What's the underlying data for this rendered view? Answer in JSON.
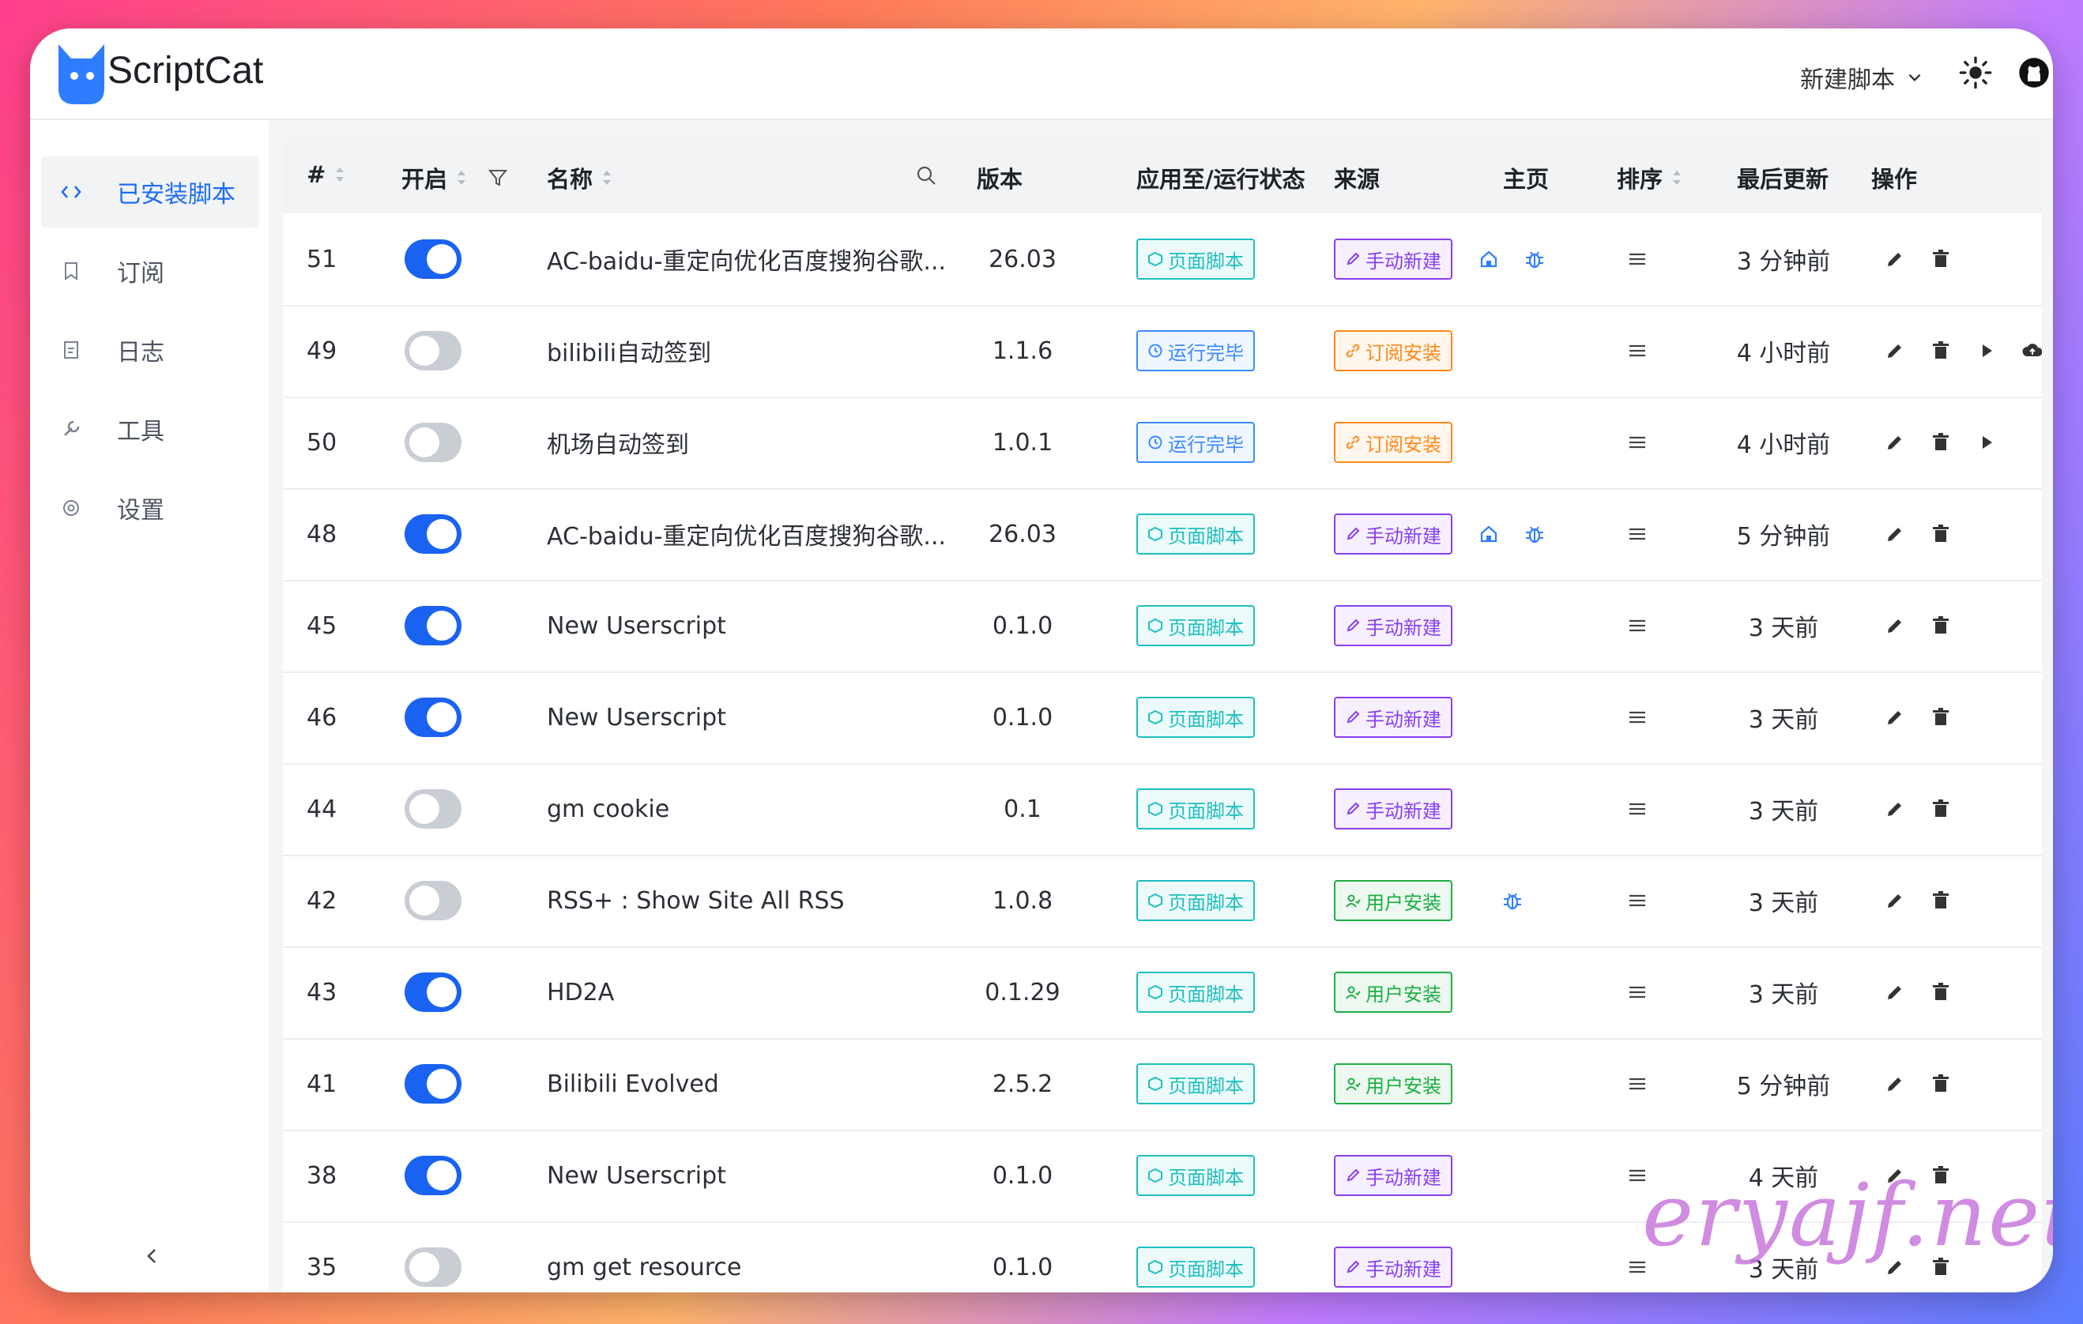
{
  "app": {
    "title": "ScriptCat"
  },
  "header": {
    "new_script_label": "新建脚本"
  },
  "sidebar": {
    "items": [
      {
        "label": "已安装脚本",
        "icon": "code-icon",
        "active": true
      },
      {
        "label": "订阅",
        "icon": "bookmark-icon",
        "active": false
      },
      {
        "label": "日志",
        "icon": "log-icon",
        "active": false
      },
      {
        "label": "工具",
        "icon": "wrench-icon",
        "active": false
      },
      {
        "label": "设置",
        "icon": "gear-icon",
        "active": false
      }
    ]
  },
  "table": {
    "columns": [
      "#",
      "开启",
      "名称",
      "版本",
      "应用至/运行状态",
      "来源",
      "主页",
      "排序",
      "最后更新",
      "操作"
    ],
    "rows": [
      {
        "id": "51",
        "enabled": true,
        "name": "AC-baidu-重定向优化百度搜狗谷歌...",
        "version": "26.03",
        "status": "页面脚本",
        "status_kind": "page",
        "source": "手动新建",
        "source_kind": "manual",
        "home": true,
        "bug": true,
        "updated": "3 分钟前",
        "play": false,
        "cloud": false
      },
      {
        "id": "49",
        "enabled": false,
        "name": "bilibili自动签到",
        "version": "1.1.6",
        "status": "运行完毕",
        "status_kind": "done",
        "source": "订阅安装",
        "source_kind": "sub",
        "home": false,
        "bug": false,
        "updated": "4 小时前",
        "play": true,
        "cloud": true
      },
      {
        "id": "50",
        "enabled": false,
        "name": "机场自动签到",
        "version": "1.0.1",
        "status": "运行完毕",
        "status_kind": "done",
        "source": "订阅安装",
        "source_kind": "sub",
        "home": false,
        "bug": false,
        "updated": "4 小时前",
        "play": true,
        "cloud": false
      },
      {
        "id": "48",
        "enabled": true,
        "name": "AC-baidu-重定向优化百度搜狗谷歌...",
        "version": "26.03",
        "status": "页面脚本",
        "status_kind": "page",
        "source": "手动新建",
        "source_kind": "manual",
        "home": true,
        "bug": true,
        "updated": "5 分钟前",
        "play": false,
        "cloud": false
      },
      {
        "id": "45",
        "enabled": true,
        "name": "New Userscript",
        "version": "0.1.0",
        "status": "页面脚本",
        "status_kind": "page",
        "source": "手动新建",
        "source_kind": "manual",
        "home": false,
        "bug": false,
        "updated": "3 天前",
        "play": false,
        "cloud": false
      },
      {
        "id": "46",
        "enabled": true,
        "name": "New Userscript",
        "version": "0.1.0",
        "status": "页面脚本",
        "status_kind": "page",
        "source": "手动新建",
        "source_kind": "manual",
        "home": false,
        "bug": false,
        "updated": "3 天前",
        "play": false,
        "cloud": false
      },
      {
        "id": "44",
        "enabled": false,
        "name": "gm cookie",
        "version": "0.1",
        "status": "页面脚本",
        "status_kind": "page",
        "source": "手动新建",
        "source_kind": "manual",
        "home": false,
        "bug": false,
        "updated": "3 天前",
        "play": false,
        "cloud": false
      },
      {
        "id": "42",
        "enabled": false,
        "name": "RSS+ : Show Site All RSS",
        "version": "1.0.8",
        "status": "页面脚本",
        "status_kind": "page",
        "source": "用户安装",
        "source_kind": "user",
        "home": false,
        "bug": true,
        "updated": "3 天前",
        "play": false,
        "cloud": false
      },
      {
        "id": "43",
        "enabled": true,
        "name": "HD2A",
        "version": "0.1.29",
        "status": "页面脚本",
        "status_kind": "page",
        "source": "用户安装",
        "source_kind": "user",
        "home": false,
        "bug": false,
        "updated": "3 天前",
        "play": false,
        "cloud": false
      },
      {
        "id": "41",
        "enabled": true,
        "name": "Bilibili Evolved",
        "version": "2.5.2",
        "status": "页面脚本",
        "status_kind": "page",
        "source": "用户安装",
        "source_kind": "user",
        "home": false,
        "bug": false,
        "updated": "5 分钟前",
        "play": false,
        "cloud": false
      },
      {
        "id": "38",
        "enabled": true,
        "name": "New Userscript",
        "version": "0.1.0",
        "status": "页面脚本",
        "status_kind": "page",
        "source": "手动新建",
        "source_kind": "manual",
        "home": false,
        "bug": false,
        "updated": "4 天前",
        "play": false,
        "cloud": false
      },
      {
        "id": "35",
        "enabled": false,
        "name": "gm get resource",
        "version": "0.1.0",
        "status": "页面脚本",
        "status_kind": "page",
        "source": "手动新建",
        "source_kind": "manual",
        "home": false,
        "bug": false,
        "updated": "3 天前",
        "play": false,
        "cloud": false
      }
    ]
  },
  "colors": {
    "accent": "#1a62f2",
    "tag_page": "#1fbfbf",
    "tag_done": "#3a8bff",
    "tag_manual": "#8a3ff0",
    "tag_sub": "#ff8a1a",
    "tag_user": "#1fae44"
  },
  "watermark": "eryajf.net"
}
